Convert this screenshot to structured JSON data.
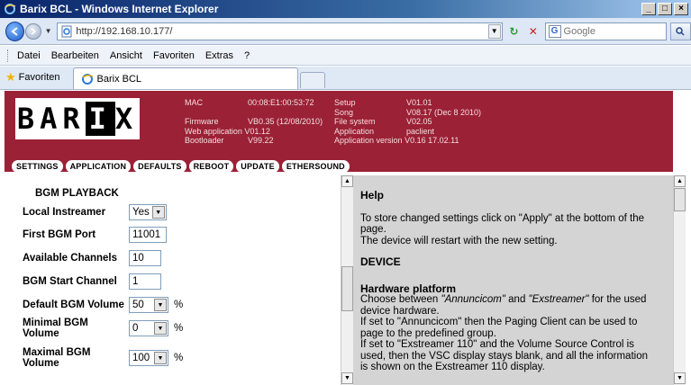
{
  "window": {
    "title": "Barix BCL - Windows Internet Explorer"
  },
  "address": {
    "url": "http://192.168.10.177/",
    "search_placeholder": "Google"
  },
  "menu": [
    "Datei",
    "Bearbeiten",
    "Ansicht",
    "Favoriten",
    "Extras",
    "?"
  ],
  "favorites": {
    "label": "Favoriten",
    "tab_title": "Barix BCL"
  },
  "banner": {
    "logo_left": "BAR",
    "logo_inv": "I",
    "logo_right": "X",
    "col1": [
      {
        "k": "MAC",
        "v": "00:08:E1:00:53:72"
      },
      {
        "k": "",
        "v": ""
      },
      {
        "k": "Firmware",
        "v": "VB0.35 (12/08/2010)"
      },
      {
        "k": "Web application",
        "v": "V01.12"
      },
      {
        "k": "Bootloader",
        "v": "V99.22"
      }
    ],
    "col2": [
      {
        "k": "Setup",
        "v": "V01.01"
      },
      {
        "k": "Song",
        "v": "V08.17 (Dec 8 2010)"
      },
      {
        "k": "File system",
        "v": "V02.05"
      },
      {
        "k": "Application",
        "v": "paclient"
      },
      {
        "k": "Application version",
        "v": "V0.16 17.02.11"
      }
    ],
    "nav": [
      "SETTINGS",
      "APPLICATION",
      "DEFAULTS",
      "REBOOT",
      "UPDATE",
      "ETHERSOUND"
    ]
  },
  "form": {
    "section": "BGM PLAYBACK",
    "local_instreamer": {
      "label": "Local Instreamer",
      "value": "Yes"
    },
    "first_port": {
      "label": "First BGM Port",
      "value": "11001"
    },
    "available_channels": {
      "label": "Available Channels",
      "value": "10"
    },
    "start_channel": {
      "label": "BGM Start Channel",
      "value": "1"
    },
    "default_volume": {
      "label": "Default BGM Volume",
      "value": "50",
      "unit": "%"
    },
    "minimal_volume": {
      "label1": "Minimal BGM",
      "label2": "Volume",
      "value": "0",
      "unit": "%"
    },
    "maximal_volume": {
      "label1": "Maximal BGM",
      "label2": "Volume",
      "value": "100",
      "unit": "%"
    }
  },
  "help": {
    "title": "Help",
    "intro1": "To store changed settings click on \"Apply\" at the bottom of the page.",
    "intro2": "The device will restart with the new setting.",
    "device_title": "DEVICE",
    "hw_title": "Hardware platform",
    "hw_p1a": "Choose between ",
    "hw_p1b": "\"Annuncicom\"",
    "hw_p1c": " and ",
    "hw_p1d": "\"Exstreamer\"",
    "hw_p1e": " for the used device hardware.",
    "hw_p2": "If set to \"Annuncicom\" then the Paging Client can be used to page to the predefined group.",
    "hw_p3": "If set to \"Exstreamer 110\" and the Volume Source Control is used, then the VSC display stays blank, and all the information is shown on the Exstreamer 110 display."
  },
  "colors": {
    "banner": "#9b2136",
    "help_bg": "#d4d4d4",
    "titlebar": "#0a246a"
  }
}
